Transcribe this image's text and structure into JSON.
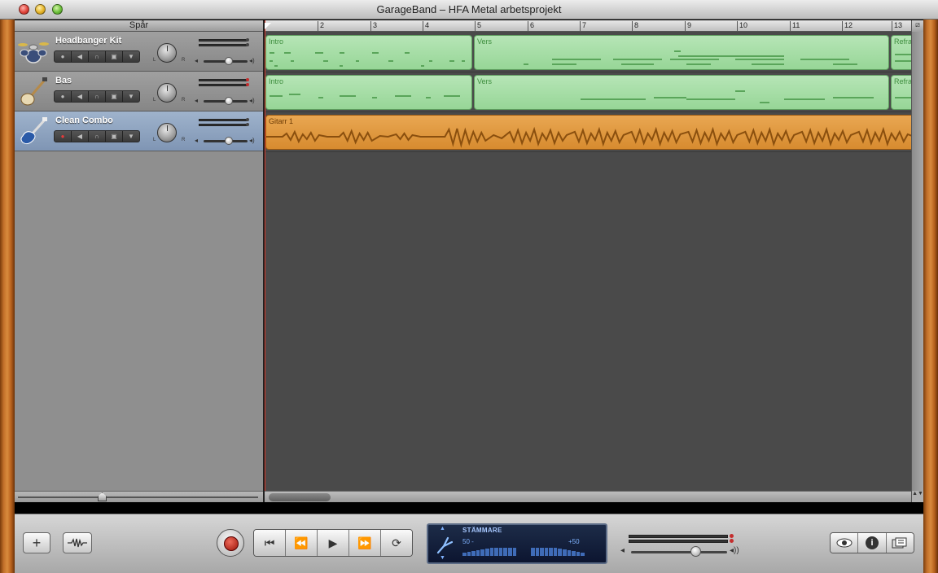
{
  "window": {
    "title": "GarageBand – HFA Metal arbetsprojekt"
  },
  "track_panel": {
    "header": "Spår"
  },
  "tracks": [
    {
      "name": "Headbanger Kit",
      "icon": "drum-kit-icon",
      "record_armed": false
    },
    {
      "name": "Bas",
      "icon": "bass-guitar-icon",
      "record_armed": false
    },
    {
      "name": "Clean Combo",
      "icon": "electric-guitar-icon",
      "record_armed": true,
      "selected": true
    }
  ],
  "pan_labels": {
    "left": "L",
    "right": "R"
  },
  "ruler": {
    "bars": [
      "2",
      "3",
      "4",
      "5",
      "6",
      "7",
      "8",
      "9",
      "10",
      "11",
      "12",
      "13"
    ]
  },
  "regions": {
    "headbanger": [
      "Intro",
      "Vers",
      "Refra"
    ],
    "bas": [
      "Intro",
      "Vers",
      "Refra"
    ],
    "clean_combo": [
      "Gitarr 1"
    ]
  },
  "lcd": {
    "mode": "STÄMMARE",
    "left_value": "50 -",
    "right_value": "+50",
    "icon": "tuning-fork-icon"
  },
  "colors": {
    "midi_region": "#97d697",
    "audio_region": "#d78b2f",
    "playhead": "#d63a2a",
    "selected_track": "#8fa4c1"
  },
  "buttons": {
    "add_track": "+",
    "loop_browser": "loop-browser-icon",
    "record": "record-icon",
    "rewind_to_start": "⏮",
    "rewind": "⏪",
    "play": "▶",
    "fast_forward": "⏩",
    "cycle": "⟳",
    "view": "eye-icon",
    "info": "i",
    "media": "media-browser-icon"
  }
}
